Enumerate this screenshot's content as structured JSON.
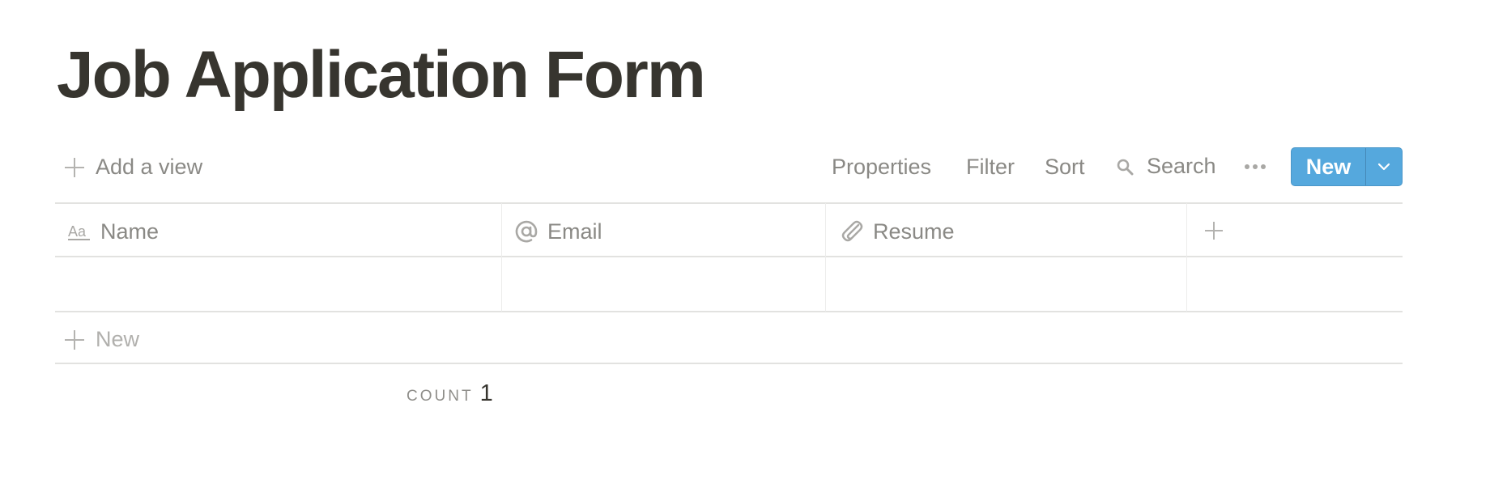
{
  "page": {
    "title": "Job Application Form"
  },
  "toolbar": {
    "add_view_label": "Add a view",
    "properties_label": "Properties",
    "filter_label": "Filter",
    "sort_label": "Sort",
    "search_label": "Search",
    "more_icon": "more-horizontal-icon",
    "new_label": "New",
    "new_dropdown_icon": "chevron-down-icon",
    "accent_color": "#55a8dd"
  },
  "table": {
    "columns": [
      {
        "label": "Name",
        "icon": "text-aa-icon"
      },
      {
        "label": "Email",
        "icon": "at-sign-icon"
      },
      {
        "label": "Resume",
        "icon": "paperclip-icon"
      }
    ],
    "add_column_icon": "plus-icon",
    "rows": [
      {
        "name": "",
        "email": "",
        "resume": ""
      }
    ],
    "new_row_label": "New"
  },
  "footer": {
    "count_label": "COUNT",
    "count_value": "1"
  }
}
